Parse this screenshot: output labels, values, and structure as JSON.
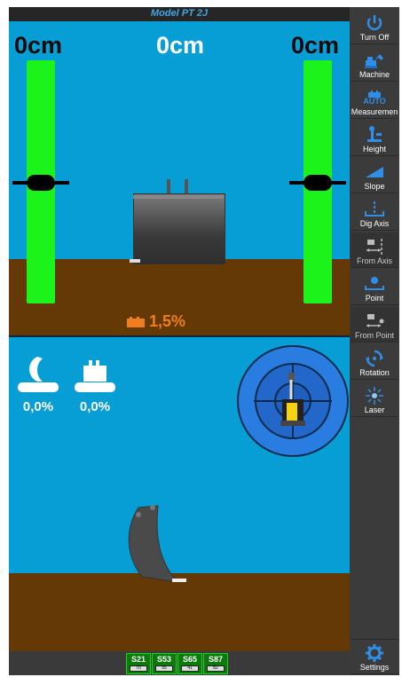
{
  "header": {
    "title": "Model PT 2J"
  },
  "top_view": {
    "left_value": "0cm",
    "center_value": "0cm",
    "right_value": "0cm",
    "slope_value": "1,5%"
  },
  "bottom_view": {
    "left_tilt_value": "0,0%",
    "right_tilt_value": "0,0%"
  },
  "sidebar": {
    "items": [
      {
        "label": "Turn Off",
        "icon": "power-icon"
      },
      {
        "label": "Machine",
        "icon": "excavator-icon"
      },
      {
        "label": "Measuremen",
        "icon": "auto-measurement-icon",
        "badge": "AUTO"
      },
      {
        "label": "Height",
        "icon": "height-icon"
      },
      {
        "label": "Slope",
        "icon": "slope-icon"
      },
      {
        "label": "Dig Axis",
        "icon": "dig-axis-icon"
      },
      {
        "label": "From Axis",
        "icon": "from-axis-icon"
      },
      {
        "label": "Point",
        "icon": "point-icon"
      },
      {
        "label": "From Point",
        "icon": "from-point-icon"
      },
      {
        "label": "Rotation",
        "icon": "rotation-icon"
      },
      {
        "label": "Laser",
        "icon": "laser-icon"
      }
    ],
    "settings_label": "Settings"
  },
  "status_bar": {
    "satellites": [
      {
        "label": "S21",
        "battery": "70"
      },
      {
        "label": "S53",
        "battery": "55"
      },
      {
        "label": "S65",
        "battery": "41"
      },
      {
        "label": "S87",
        "battery": "82"
      }
    ]
  },
  "colors": {
    "sky": "#079ed6",
    "ground": "#653905",
    "level_bar": "#1bf31b",
    "slope_text": "#f07d1f",
    "sidebar_bg": "#3b3b3b",
    "icon_blue": "#2f8fe8"
  }
}
